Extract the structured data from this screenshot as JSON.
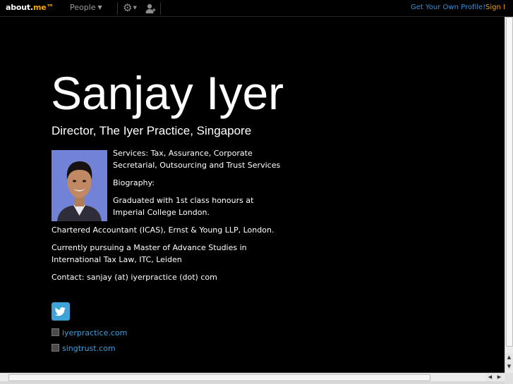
{
  "topbar": {
    "logo_text": "about.",
    "logo_accent": "me™",
    "people_label": "People",
    "get_profile_label": "Get Your Own Profile!",
    "sign_in_label": "Sign In",
    "icons": [
      "settings-gear-icon",
      "add-person-icon"
    ]
  },
  "profile": {
    "name": "Sanjay Iyer",
    "headline": "Director, The Iyer Practice, Singapore",
    "bio": [
      "Services: Tax, Assurance, Corporate Secretarial, Outsourcing and Trust Services",
      "Biography:",
      "Graduated with 1st class honours at Imperial College London.",
      "Chartered Accountant (ICAS), Ernst & Young LLP, London.",
      "Currently pursuing a Master of Advance Studies in International Tax Law, ITC, Leiden",
      "Contact: sanjay (at) iyerpractice (dot) com"
    ]
  },
  "social": {
    "twitter_icon": "twitter-bird-icon",
    "links": [
      {
        "label": "iyerpractice.com"
      },
      {
        "label": "singtrust.com"
      }
    ]
  },
  "colors": {
    "background": "#000000",
    "link": "#3ea0e0",
    "get_profile": "#3b8fd0",
    "sign_in": "#e8a400",
    "logo_accent": "#f7a800",
    "twitter": "#3fa2d6"
  }
}
